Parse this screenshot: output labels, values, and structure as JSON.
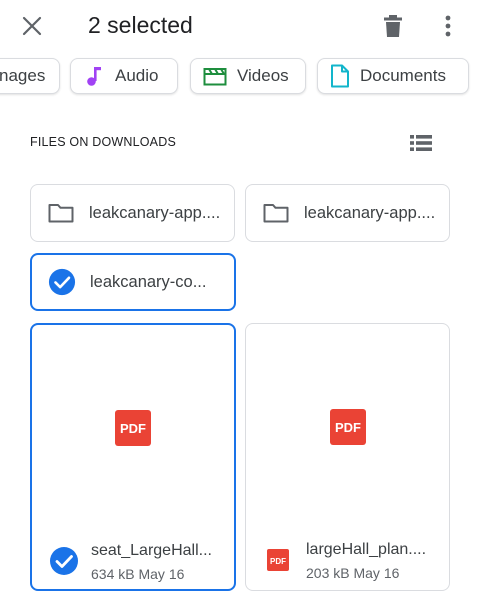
{
  "toolbar": {
    "title": "2 selected",
    "close_icon": "close-icon",
    "delete_icon": "trash-icon",
    "more_icon": "more-vert-icon"
  },
  "categories": [
    {
      "label": "nages",
      "icon": "image-icon"
    },
    {
      "label": "Audio",
      "icon": "music-note-icon",
      "color": "#a142f4"
    },
    {
      "label": "Videos",
      "icon": "clapperboard-icon",
      "color": "#1e8e3e"
    },
    {
      "label": "Documents",
      "icon": "document-icon",
      "color": "#12b5cb"
    }
  ],
  "section": {
    "title": "FILES ON DOWNLOADS",
    "view_toggle_icon": "list-view-icon"
  },
  "folders": [
    {
      "name": "leakcanary-app....",
      "selected": false
    },
    {
      "name": "leakcanary-app....",
      "selected": false
    },
    {
      "name": "leakcanary-co...",
      "selected": true
    }
  ],
  "files": [
    {
      "name": "seat_LargeHall...",
      "size": "634 kB",
      "date": "May 16",
      "meta": "634 kB May 16",
      "selected": true,
      "type_label": "PDF"
    },
    {
      "name": "largeHall_plan....",
      "size": "203 kB",
      "date": "May 16",
      "meta": "203 kB May 16",
      "selected": false,
      "type_label": "PDF"
    }
  ],
  "colors": {
    "accent": "#1a73e8",
    "pdf_red": "#ea4335",
    "icon_gray": "#5f6368"
  }
}
